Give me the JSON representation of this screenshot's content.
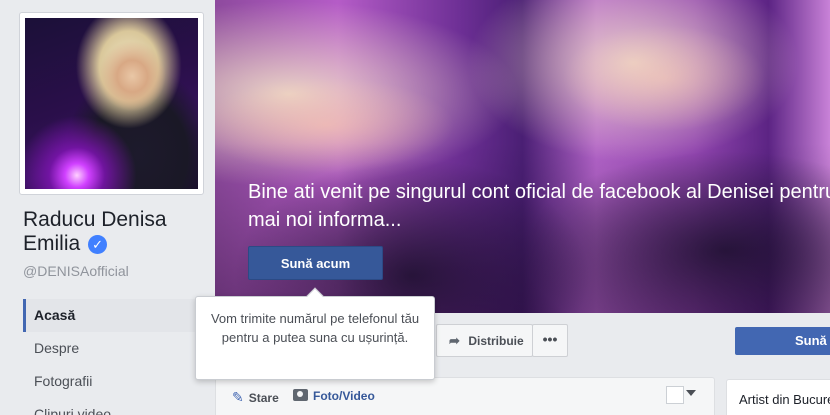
{
  "profile": {
    "name": "Raducu Denisa Emilia",
    "verified_mark": "✓",
    "handle": "@DENISAofficial"
  },
  "nav": {
    "items": [
      {
        "label": "Acasă",
        "active": true
      },
      {
        "label": "Despre",
        "active": false
      },
      {
        "label": "Fotografii",
        "active": false
      },
      {
        "label": "Clipuri video",
        "active": false
      }
    ]
  },
  "cover": {
    "welcome_text_line1": "Bine ati venit pe singurul cont oficial de facebook al Denisei pentru",
    "welcome_text_line2": "mai noi informa...",
    "call_button": "Sună acum"
  },
  "tooltip": {
    "text": "Vom trimite numărul pe telefonul tău pentru a putea suna cu ușurință."
  },
  "actions": {
    "share_label": "Distribuie",
    "share_icon": "share-arrow",
    "more_label": "•••",
    "right_button_label": "Sună acum"
  },
  "composer": {
    "status_label": "Stare",
    "status_icon": "pencil",
    "photo_label": "Foto/Video",
    "photo_icon": "camera"
  },
  "about": {
    "label": "Artist din București"
  },
  "colors": {
    "brand_blue": "#4267b2",
    "dark_blue": "#365899",
    "page_bg": "#e9ebee",
    "verified": "#4080ff"
  }
}
